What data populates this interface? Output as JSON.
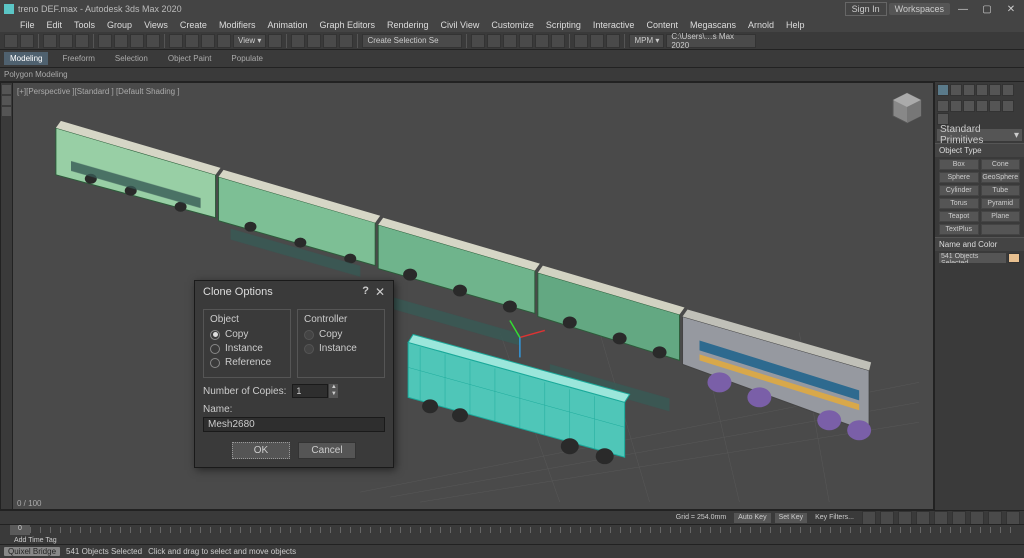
{
  "titlebar": {
    "filename": "treno DEF.max - Autodesk 3ds Max 2020",
    "signin": "Sign In",
    "workspaces": "Workspaces"
  },
  "menus": [
    "File",
    "Edit",
    "Tools",
    "Group",
    "Views",
    "Create",
    "Modifiers",
    "Animation",
    "Graph Editors",
    "Rendering",
    "Civil View",
    "Customize",
    "Scripting",
    "Interactive",
    "Content",
    "Megascans",
    "Arnold",
    "Help"
  ],
  "toolbar": {
    "selection_dropdown": "Create Selection Se",
    "path": "C:\\Users\\…s Max 2020"
  },
  "ribbon": {
    "tabs": [
      "Modeling",
      "Freeform",
      "Selection",
      "Object Paint",
      "Populate"
    ],
    "sub": "Polygon Modeling"
  },
  "viewport": {
    "label": "[+][Perspective ][Standard ] [Default Shading ]",
    "frame": "0 / 100"
  },
  "cmdpanel": {
    "dropdown": "Standard Primitives",
    "roll1": "Object Type",
    "prims": [
      [
        "Box",
        "Cone"
      ],
      [
        "Sphere",
        "GeoSphere"
      ],
      [
        "Cylinder",
        "Tube"
      ],
      [
        "Torus",
        "Pyramid"
      ],
      [
        "Teapot",
        "Plane"
      ],
      [
        "TextPlus",
        ""
      ]
    ],
    "roll2": "Name and Color",
    "sel": "541 Objects Selected"
  },
  "dialog": {
    "title": "Clone Options",
    "grp_object": "Object",
    "grp_controller": "Controller",
    "opt_copy": "Copy",
    "opt_instance": "Instance",
    "opt_reference": "Reference",
    "num_copies_lbl": "Number of Copies:",
    "num_copies": "1",
    "name_lbl": "Name:",
    "name": "Mesh2680",
    "ok": "OK",
    "cancel": "Cancel"
  },
  "timebar": {
    "grid": "Grid = 254.0mm",
    "addtag": "Add Time Tag",
    "autokey": "Auto Key",
    "setkey": "Set Key",
    "keyfilters": "Key Filters..."
  },
  "status": {
    "chip": "Quixel Bridge",
    "sel": "541 Objects Selected",
    "hint": "Click and drag to select and move objects"
  }
}
